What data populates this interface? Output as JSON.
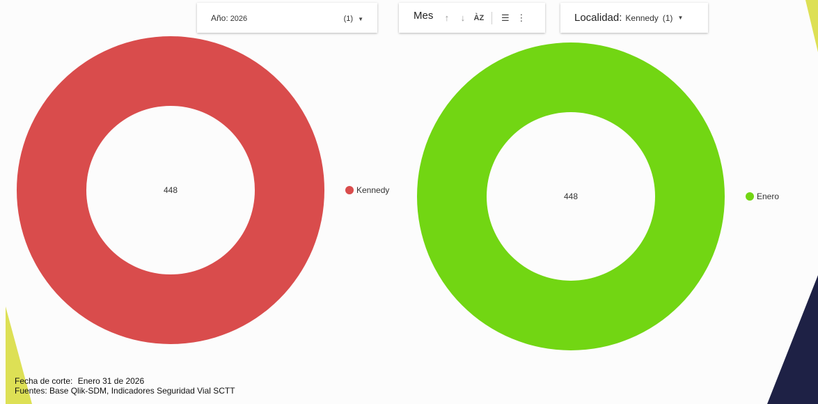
{
  "filters": {
    "year": {
      "label": "Año:",
      "value": "2026",
      "count": "(1)"
    },
    "month": {
      "label": "Mes"
    },
    "locality": {
      "label": "Localidad:",
      "value": "Kennedy",
      "count": "(1)"
    }
  },
  "chart_data": [
    {
      "type": "pie",
      "variant": "donut",
      "center_label": "448",
      "categories": [
        "Kennedy"
      ],
      "values": [
        448
      ],
      "colors": [
        "#d94c4c"
      ],
      "legend_position": "right"
    },
    {
      "type": "pie",
      "variant": "donut",
      "center_label": "448",
      "categories": [
        "Enero"
      ],
      "values": [
        448
      ],
      "colors": [
        "#72d613"
      ],
      "legend_position": "right"
    }
  ],
  "footer": {
    "cutoff_label": "Fecha de corte:",
    "cutoff_value": "Enero 31 de 2026",
    "sources": "Fuentes: Base Qlik-SDM, Indicadores Seguridad Vial SCTT"
  },
  "colors": {
    "background": "#fcfcfc",
    "accent_yellow": "#dde055",
    "accent_navy": "#1e2145"
  }
}
